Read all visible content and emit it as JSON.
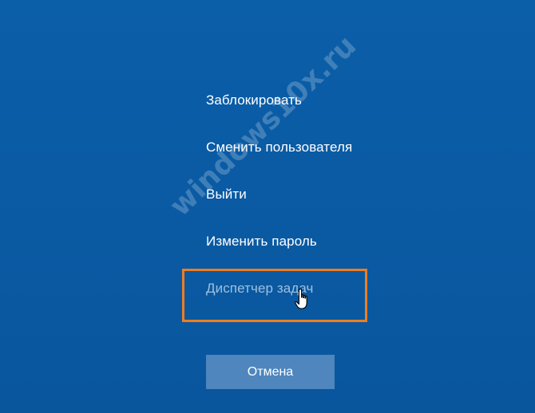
{
  "menu": {
    "items": [
      {
        "label": "Заблокировать"
      },
      {
        "label": "Сменить пользователя"
      },
      {
        "label": "Выйти"
      },
      {
        "label": "Изменить пароль"
      },
      {
        "label": "Диспетчер задач"
      }
    ]
  },
  "cancel_label": "Отмена",
  "watermark_text": "windows10x.ru",
  "colors": {
    "background": "#0a5aa3",
    "highlight": "#ee7d22",
    "button": "#4e86bd"
  }
}
